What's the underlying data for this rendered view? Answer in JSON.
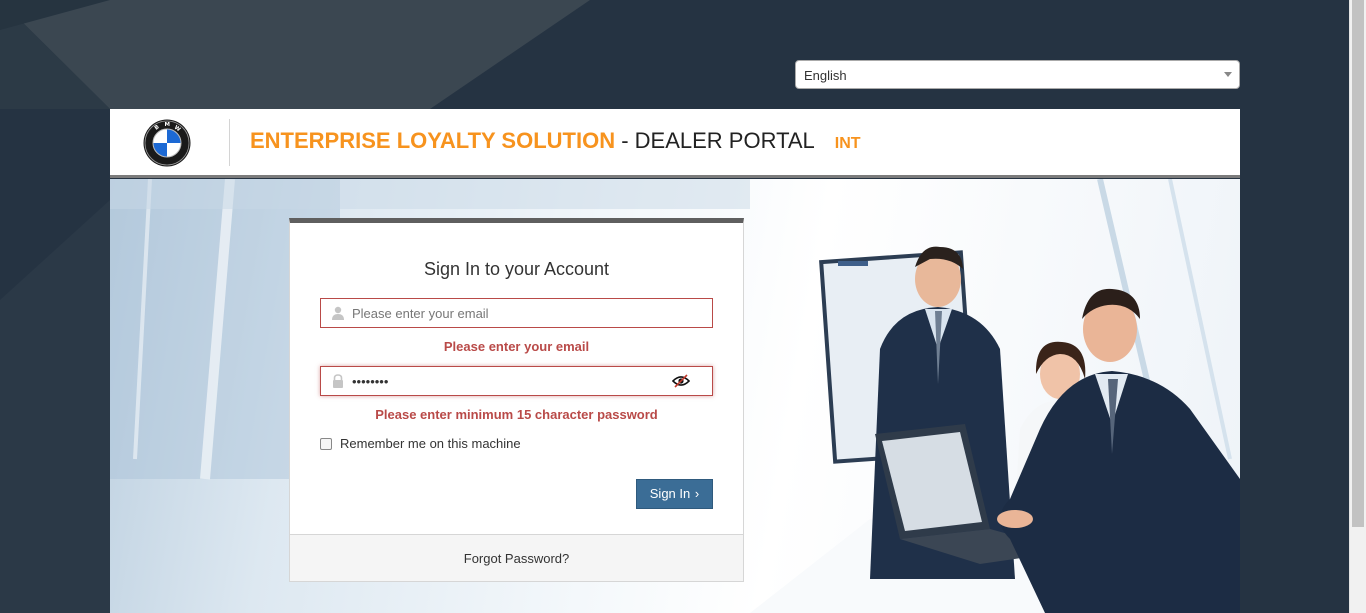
{
  "language_select": {
    "value": "English"
  },
  "header": {
    "title_primary": "ENTERPRISE LOYALTY SOLUTION",
    "title_separator": " - ",
    "title_secondary": "DEALER PORTAL",
    "environment": "INT",
    "logo_icon": "bmw-logo-icon",
    "colors": {
      "accent": "#f7931e",
      "header_border": "#7c7c7c"
    }
  },
  "login": {
    "heading": "Sign In to your Account",
    "email": {
      "placeholder": "Please enter your email",
      "value": "",
      "icon": "user-icon",
      "error": "Please enter your email"
    },
    "password": {
      "value": "••••••••",
      "icon": "lock-icon",
      "toggle_icon": "eye-slash-icon",
      "error": "Please enter minimum 15 character password"
    },
    "remember_label": "Remember me on this machine",
    "remember_checked": false,
    "signin_label": "Sign In",
    "forgot_label": "Forgot Password?",
    "colors": {
      "error": "#b94a48",
      "button": "#3b6d96"
    }
  }
}
